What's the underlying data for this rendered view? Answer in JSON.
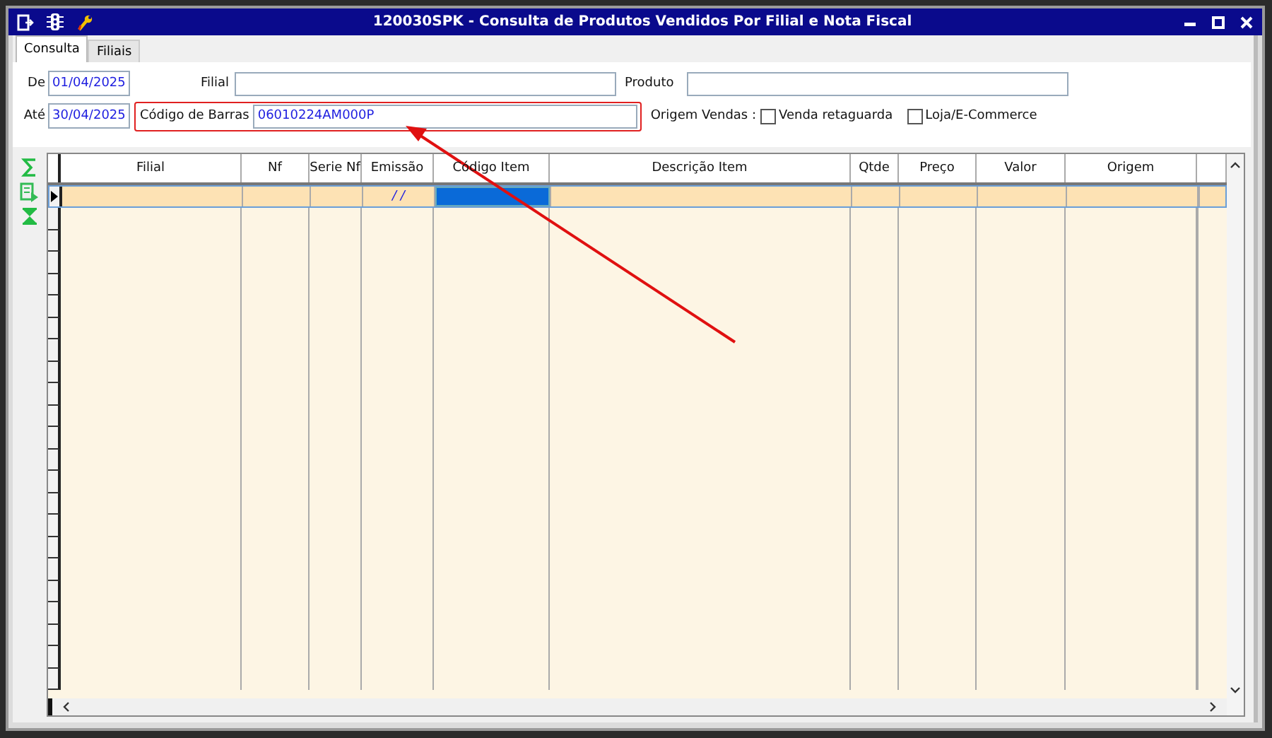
{
  "window": {
    "title": "120030SPK - Consulta de Produtos Vendidos Por Filial e Nota Fiscal"
  },
  "tabs": [
    {
      "label": "Consulta",
      "selected": true
    },
    {
      "label": "Filiais",
      "selected": false
    }
  ],
  "form": {
    "de_label": "De",
    "de_value": "01/04/2025",
    "ate_label": "Até",
    "ate_value": "30/04/2025",
    "filial_label": "Filial",
    "produto_label": "Produto",
    "barcode_label": "Código de Barras",
    "barcode_value": "06010224AM000P",
    "origem_label": "Origem Vendas :",
    "options": [
      {
        "label": "Venda retaguarda",
        "checked": false
      },
      {
        "label": "Loja/E-Commerce",
        "checked": false
      }
    ]
  },
  "table": {
    "columns": [
      "Filial",
      "Nf",
      "Serie Nf",
      "Emissão",
      "Código Item",
      "Descrição Item",
      "Qtde",
      "Preço",
      "Valor",
      "Origem"
    ],
    "rows": [
      {
        "selected": true,
        "emissao": "/ /",
        "code_focused": true
      }
    ]
  }
}
